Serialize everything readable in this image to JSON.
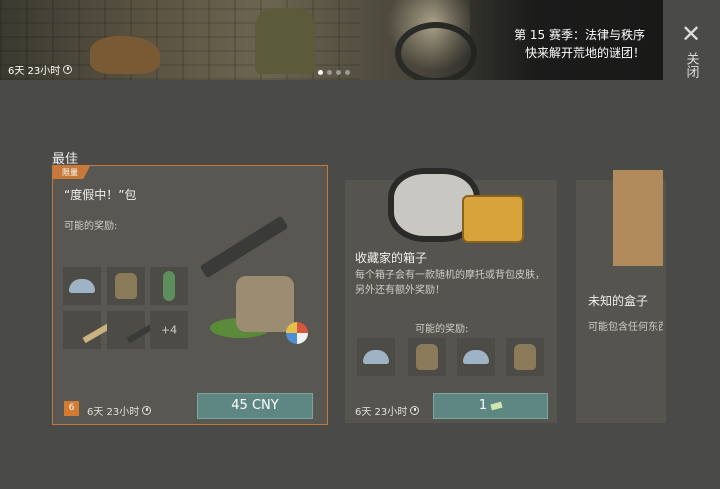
{
  "banner": {
    "season_title": "第 15 赛季：法律与秩序",
    "season_subtitle": "快来解开荒地的谜团！",
    "timer": "6天 23小时",
    "pages": 4,
    "active_page": 1
  },
  "close": {
    "label": "关闭"
  },
  "section": {
    "title": "最佳"
  },
  "offers": [
    {
      "badge": "限量",
      "title": "“度假中！”包",
      "possible_rewards_label": "可能的奖励:",
      "rewards": [
        "helmet-icon",
        "backpack-icon",
        "surfboard-icon",
        "rifle-icon",
        "rifle-icon",
        "+4"
      ],
      "level": "6",
      "timer": "6天 23小时",
      "price": "45 CNY",
      "accent_color": "#c6793a"
    },
    {
      "title": "收藏家的箱子",
      "description": "每个箱子会有一款随机的摩托或背包皮肤，另外还有额外奖励！",
      "possible_rewards_label": "可能的奖励:",
      "rewards": [
        "helmet-icon",
        "backpack-icon",
        "helmet-icon",
        "backpack-icon"
      ],
      "timer": "6天 23小时",
      "price": "1"
    },
    {
      "title": "未知的盒子",
      "description": "可能包含任何东西"
    }
  ]
}
